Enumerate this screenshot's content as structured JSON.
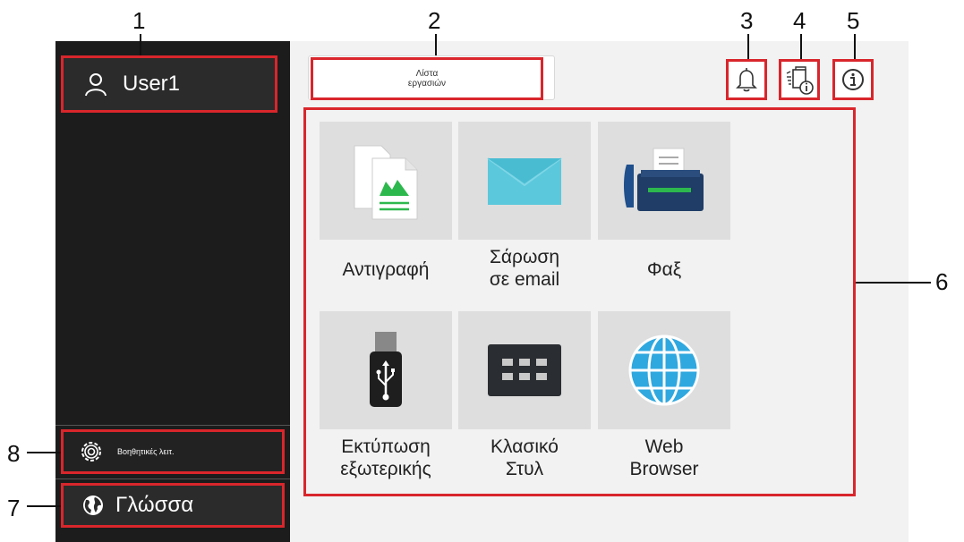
{
  "callouts": [
    "1",
    "2",
    "3",
    "4",
    "5",
    "6",
    "7",
    "8"
  ],
  "user": {
    "name": "User1",
    "icon": "user-icon"
  },
  "sidebar": {
    "aux_label": "Βοηθητικές λειτ.",
    "aux_icon": "gear-icon",
    "language_label": "Γλώσσα",
    "language_icon": "globe-icon"
  },
  "header": {
    "job_list_label": "Λίστα εργασιών",
    "bell_icon": "bell-icon",
    "device_status_icon": "device-info-icon",
    "info_icon": "info-icon"
  },
  "apps": [
    {
      "line1": "Αντιγραφή",
      "line2": "",
      "icon": "copy-icon"
    },
    {
      "line1": "Σάρωση",
      "line2": "σε email",
      "icon": "envelope-icon"
    },
    {
      "line1": "Φαξ",
      "line2": "",
      "icon": "fax-icon"
    },
    {
      "line1": "Εκτύπωση",
      "line2": "εξωτερικής",
      "icon": "usb-icon"
    },
    {
      "line1": "Κλασικό",
      "line2": "Στυλ",
      "icon": "keypad-icon"
    },
    {
      "line1": "Web",
      "line2": "Browser",
      "icon": "globe-icon"
    }
  ],
  "colors": {
    "highlight": "#d9262c",
    "sidebar": "#1c1c1c",
    "main_bg": "#f2f2f2"
  }
}
